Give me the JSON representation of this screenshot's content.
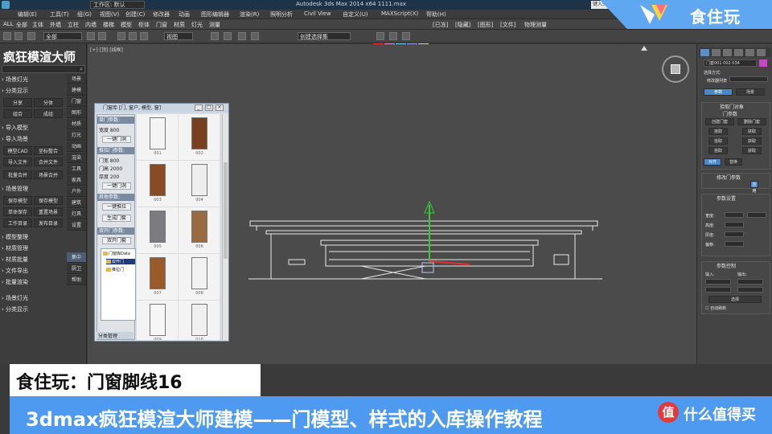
{
  "titlebar": {
    "workspace": "工作区: 默认",
    "app_title": "Autodesk 3ds Max 2014 x64   1111.max",
    "search_placeholder": "键入关键字"
  },
  "menubar": {
    "items": [
      "编辑(E)",
      "工具(T)",
      "组(G)",
      "视图(V)",
      "创建(C)",
      "修改器",
      "动画",
      "图形编辑器",
      "渲染(R)",
      "照明分析",
      "Civil View",
      "自定义(U)",
      "MAXScript(X)",
      "帮助(H)"
    ]
  },
  "toolbar": {
    "items": [
      "ALL",
      "全部",
      "主体",
      "外墙",
      "立柱",
      "内墙",
      "楼梯",
      "模型",
      "柜体",
      "门窗",
      "材质",
      "灯光",
      "测量"
    ],
    "right_items": [
      "[已冻]",
      "[隐藏]",
      "[图形]",
      "[文件]",
      "物理测量"
    ],
    "selection_filter": "全部",
    "ref_coord": "视图",
    "named_set": "创建选择集"
  },
  "brand": {
    "name": "食住玩"
  },
  "plugin": {
    "title": "疯狂模渲大师",
    "sections": [
      "场景灯光",
      "分类显示",
      "导入模型",
      "导入场景",
      "场景管理",
      "模型整理",
      "材质管理",
      "材质批量",
      "文件导出",
      "批量渲染"
    ],
    "buttons": [
      "分享",
      "分体",
      "组合",
      "成组",
      "模型CAD",
      "坐标整合",
      "导入文件",
      "合并文件",
      "批量合并",
      "场景合并",
      "保存模型",
      "保存模型",
      "单体保存",
      "重置场景",
      "工作目录",
      "发布目录"
    ],
    "side_tabs": [
      "场景",
      "建模",
      "门窗",
      "图形",
      "材质",
      "灯光",
      "动画",
      "渲染",
      "工具",
      "家具",
      "户外",
      "建筑",
      "灯具",
      "设置",
      "集中",
      "厨卫",
      "帮助"
    ]
  },
  "viewport": {
    "label": "[+] [顶] [线框]"
  },
  "library": {
    "title": "门窗库 [门, 窗户, 模型, 窗]",
    "controls": [
      "_",
      "□",
      "×"
    ],
    "groups": [
      {
        "head": "单门参数:",
        "rows": [
          "宽度 800"
        ],
        "button": "一键门洞"
      },
      {
        "head": "推拉门参数:",
        "rows": [
          "门宽 800",
          "门高 2000",
          "厚度 200"
        ],
        "button": "一键门洞"
      },
      {
        "head": "其他参数:",
        "rows": [],
        "button": "一键推拉"
      },
      {
        "head": "双开门参数:",
        "rows": [],
        "button": "双开门套"
      }
    ],
    "extra_button": "生成门套",
    "tree": [
      "门窗库Data",
      "双开门",
      "推拉门"
    ],
    "footer": "分类管理",
    "captions": [
      "001",
      "002",
      "003",
      "004",
      "005",
      "006",
      "007",
      "008",
      "009",
      "010"
    ]
  },
  "command": {
    "object_name": "门套001 002 034",
    "modifier_list": "修改器列表",
    "pick_label": "选择方式:",
    "sections": [
      "拾取门对象",
      "门参数",
      "修改门参数",
      "参数设置",
      "参数控制"
    ],
    "buttons": [
      "参数",
      "场景",
      "创建门套",
      "删除门套",
      "拾取",
      "获取",
      "对齐",
      "替换",
      "应用",
      "选择"
    ],
    "fields": [
      "宽度:",
      "高度:",
      "厚度:",
      "偏移:",
      "输入:",
      "输出:"
    ],
    "checkbox_label": "自动刷新"
  },
  "captions": {
    "subtitle": "食住玩：门窗脚线16",
    "title": "3dmax疯狂模渲大师建模——门模型、样式的入库操作教程"
  },
  "watermark": {
    "badge": "值",
    "text": "什么值得买"
  },
  "colors": {
    "brand_blue": "#5fa7f0",
    "caption_blue": "#4d9af0",
    "watermark_red": "#e23a3a",
    "viewport_gray": "#4b4b4b"
  }
}
